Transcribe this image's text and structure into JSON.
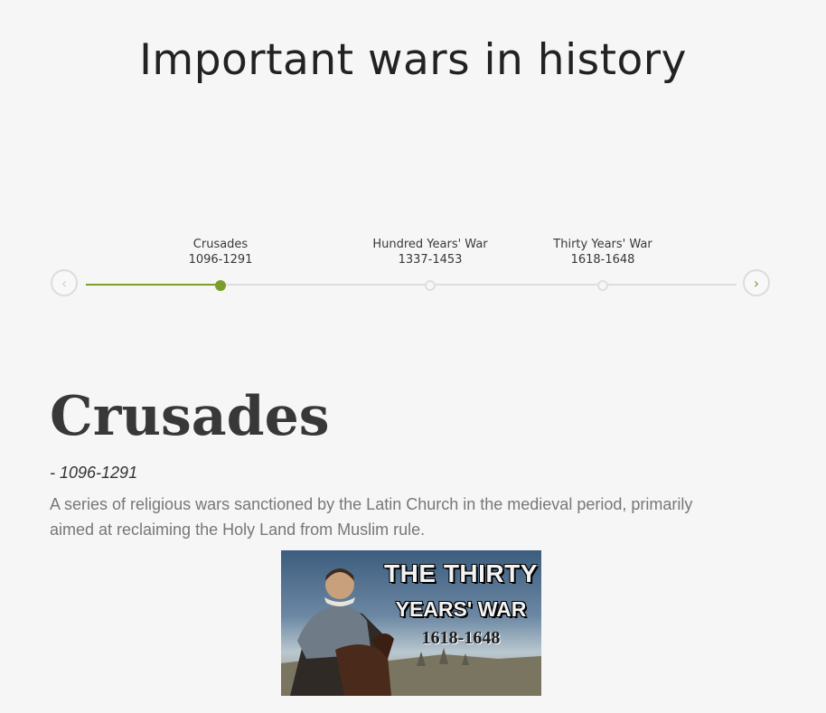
{
  "page": {
    "title": "Important wars in history"
  },
  "timeline": {
    "prev_icon": "chevron-left-icon",
    "next_icon": "chevron-right-icon",
    "events": [
      {
        "name": "Crusades",
        "date": "1096-1291",
        "active": true
      },
      {
        "name": "Hundred Years' War",
        "date": "1337-1453",
        "active": false
      },
      {
        "name": "Thirty Years' War",
        "date": "1618-1648",
        "active": false
      }
    ]
  },
  "content": {
    "title": "Crusades",
    "date": "- 1096-1291",
    "description": "A series of religious wars sanctioned by the Latin Church in the medieval period, primarily aimed at reclaiming the Holy Land from Muslim rule."
  },
  "image": {
    "line1": "THE THIRTY",
    "line2": "YEARS' WAR",
    "line3": "1618-1648"
  },
  "colors": {
    "accent": "#7b9e2a",
    "track": "#dedede",
    "background": "#f6f6f6"
  }
}
